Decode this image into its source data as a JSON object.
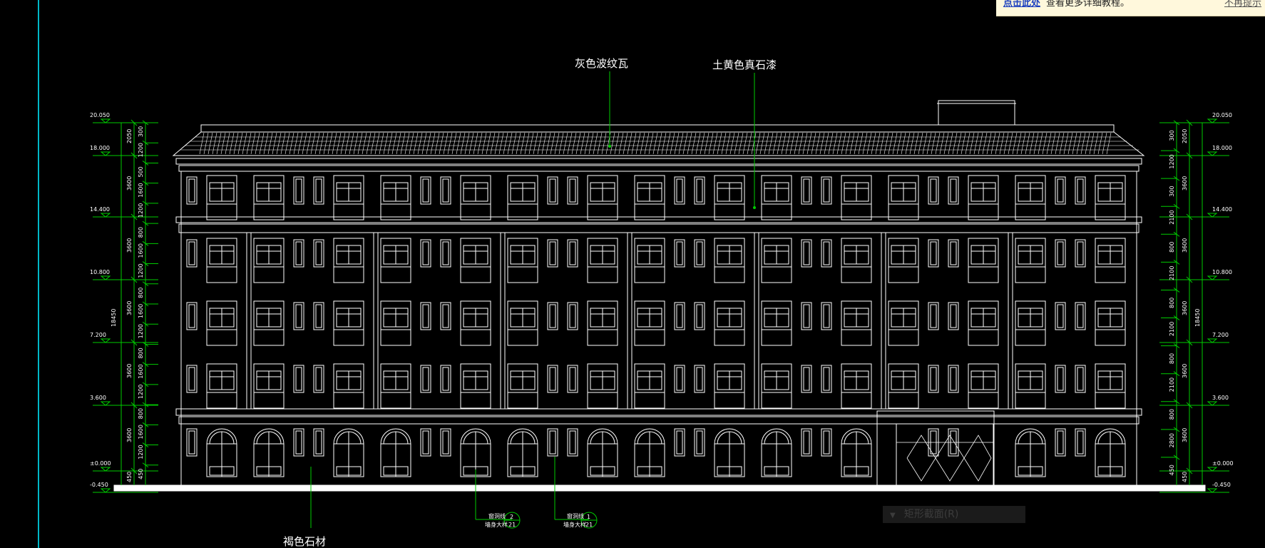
{
  "colors": {
    "background": "#000000",
    "line": "#ffffff",
    "dimension": "#00cc00",
    "leader": "#00cc00",
    "frame": "#00b7c7"
  },
  "notification": {
    "link_text": "点击此处",
    "message": "查看更多详细教程。",
    "close_text": "不再提示"
  },
  "tooltip": {
    "icon": "caret-down-icon",
    "label": "矩形截面(R)"
  },
  "annotations": {
    "roof_tile": "灰色波纹瓦",
    "upper_wall": "土黄色真石漆",
    "base_stone": "褐色石材",
    "callout_a_line1": "窗洞线",
    "callout_a_line2": "墙身大样",
    "callout_a_num": "2",
    "callout_a_sheet": "21",
    "callout_b_line1": "窗洞线",
    "callout_b_line2": "墙身大样",
    "callout_b_num": "1",
    "callout_b_sheet": "21"
  },
  "elevations_left": [
    "20.050",
    "18.000",
    "14.400",
    "10.800",
    "7.200",
    "3.600",
    "±0.000",
    "-0.450"
  ],
  "elevations_right": [
    "20.050",
    "18.000",
    "14.400",
    "10.800",
    "7.200",
    "3.600",
    "±0.000",
    "-0.450"
  ],
  "dims_left_outer": [
    "2050",
    "3600",
    "3600",
    "3600",
    "3600",
    "3600",
    "450"
  ],
  "dims_left_inner": [
    "300",
    "1200",
    "500",
    "1600",
    "1200",
    "800",
    "1600",
    "1200",
    "800",
    "1600",
    "1200",
    "800",
    "1600",
    "1200",
    "800",
    "1600",
    "1200",
    "450"
  ],
  "dims_left_total": "18450",
  "dims_right_outer": [
    "2050",
    "3600",
    "3600",
    "3600",
    "3600",
    "3600",
    "450"
  ],
  "dims_right_inner": [
    "300",
    "1200",
    "300",
    "2100",
    "800",
    "2100",
    "800",
    "2100",
    "800",
    "2100",
    "800",
    "2800",
    "450"
  ],
  "dims_right_total": "18450"
}
